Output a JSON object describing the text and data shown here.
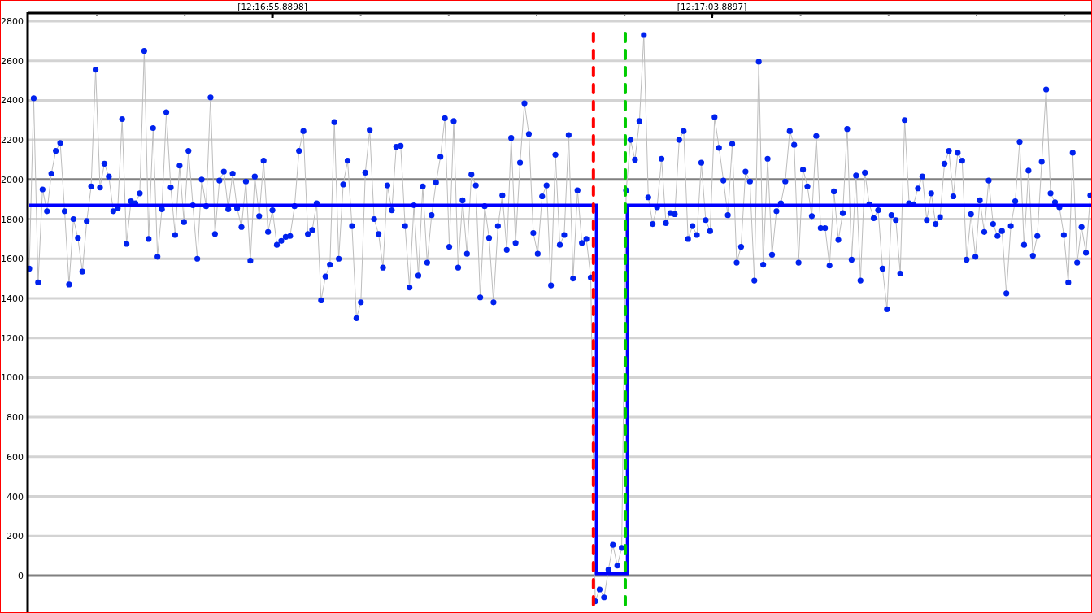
{
  "chart": {
    "chart_data": {
      "type": "line",
      "grid": true,
      "ylim": [
        -185,
        2845
      ],
      "yticks": [
        0,
        200,
        400,
        600,
        800,
        1000,
        1200,
        1400,
        1600,
        1800,
        2000,
        2200,
        2400,
        2600,
        2800
      ],
      "series": [
        {
          "color": "#0022ee",
          "marker": "circle",
          "values": [
            1550,
            2410,
            1480,
            1950,
            1840,
            2030,
            2145,
            2185,
            1840,
            1470,
            1800,
            1705,
            1535,
            1790,
            1965,
            2555,
            1960,
            2080,
            2015,
            1840,
            1855,
            2305,
            1675,
            1890,
            1880,
            1930,
            2650,
            1700,
            2260,
            1610,
            1850,
            2340,
            1960,
            1720,
            2070,
            1785,
            2145,
            1870,
            1600,
            2000,
            1865,
            2415,
            1725,
            1995,
            2040,
            1850,
            2030,
            1855,
            1760,
            1990,
            1590,
            2015,
            1815,
            2095,
            1735,
            1845,
            1670,
            1690,
            1710,
            1715,
            1865,
            2145,
            2245,
            1725,
            1745,
            1880,
            1390,
            1510,
            1570,
            2290,
            1600,
            1975,
            2095,
            1765,
            1300,
            1380,
            2035,
            2250,
            1800,
            1725,
            1555,
            1970,
            1845,
            2165,
            2170,
            1765,
            1455,
            1870,
            1515,
            1965,
            1580,
            1820,
            1985,
            2115,
            2310,
            1660,
            2295,
            1555,
            1895,
            1625,
            2025,
            1970,
            1405,
            1865,
            1705,
            1380,
            1765,
            1920,
            1645,
            2210,
            1680,
            2085,
            2385,
            2230,
            1730,
            1625,
            1915,
            1970,
            1465,
            2125,
            1670,
            1720,
            2225,
            1500,
            1945,
            1680,
            1700,
            1505,
            -130,
            -70,
            -110,
            30,
            155,
            50,
            140,
            1945,
            2200,
            2100,
            2295,
            2730,
            1910,
            1775,
            1860,
            2105,
            1780,
            1830,
            1825,
            2200,
            2245,
            1700,
            1765,
            1720,
            2085,
            1795,
            1740,
            2315,
            2160,
            1995,
            1820,
            2180,
            1580,
            1660,
            2040,
            1990,
            1490,
            2595,
            1570,
            2105,
            1620,
            1840,
            1880,
            1990,
            2245,
            2175,
            1580,
            2050,
            1965,
            1815,
            2220,
            1755,
            1755,
            1565,
            1940,
            1695,
            1830,
            2255,
            1595,
            2020,
            1490,
            2035,
            1875,
            1805,
            1845,
            1550,
            1345,
            1820,
            1795,
            1525,
            2300,
            1880,
            1875,
            1955,
            2015,
            1795,
            1930,
            1775,
            1810,
            2080,
            2145,
            1915,
            2135,
            2095,
            1595,
            1825,
            1610,
            1895,
            1735,
            1995,
            1775,
            1715,
            1740,
            1425,
            1765,
            1890,
            2190,
            1670,
            2045,
            1615,
            1715,
            2090,
            2455,
            1930,
            1885,
            1860,
            1720,
            1480,
            2135,
            1580,
            1760,
            1630,
            1920
          ]
        },
        {
          "color": "#0000ff",
          "values": [
            1870,
            1870,
            1870,
            1870,
            1870,
            1870,
            1870,
            1870,
            1870,
            1870,
            1870,
            1870,
            1870,
            1870,
            1870,
            1870,
            1870,
            1870,
            1870,
            1870,
            1870,
            1870,
            1870,
            1870,
            1870,
            1870,
            1870,
            1870,
            1870,
            1870,
            1870,
            1870,
            1870,
            1870,
            1870,
            1870,
            1870,
            1870,
            1870,
            1870,
            1870,
            1870,
            1870,
            1870,
            1870,
            1870,
            1870,
            1870,
            1870,
            1870,
            1870,
            1870,
            1870,
            1870,
            1870,
            1870,
            1870,
            1870,
            1870,
            1870,
            1870,
            1870,
            1870,
            1870,
            1870,
            1870,
            1870,
            1870,
            1870,
            1870,
            1870,
            1870,
            1870,
            1870,
            1870,
            1870,
            1870,
            1870,
            1870,
            1870,
            1870,
            1870,
            1870,
            1870,
            1870,
            1870,
            1870,
            1870,
            1870,
            1870,
            1870,
            1870,
            1870,
            1870,
            1870,
            1870,
            1870,
            1870,
            1870,
            1870,
            1870,
            1870,
            1870,
            1870,
            1870,
            1870,
            1870,
            1870,
            1870,
            1870,
            1870,
            1870,
            1870,
            1870,
            1870,
            1870,
            1870,
            1870,
            1870,
            1870,
            1870,
            1870,
            1870,
            1870,
            1870,
            1870,
            1870,
            1870,
            1870,
            10,
            10,
            10,
            10,
            10,
            10,
            10,
            1870,
            1870,
            1870,
            1870,
            1870,
            1870,
            1870,
            1870,
            1870,
            1870,
            1870,
            1870,
            1870,
            1870,
            1870,
            1870,
            1870,
            1870,
            1870,
            1870,
            1870,
            1870,
            1870,
            1870,
            1870,
            1870,
            1870,
            1870,
            1870,
            1870,
            1870,
            1870,
            1870,
            1870,
            1870,
            1870,
            1870,
            1870,
            1870,
            1870,
            1870,
            1870,
            1870,
            1870,
            1870,
            1870,
            1870,
            1870,
            1870,
            1870,
            1870,
            1870,
            1870,
            1870,
            1870,
            1870,
            1870,
            1870,
            1870,
            1870,
            1870,
            1870,
            1870,
            1870,
            1870,
            1870,
            1870,
            1870,
            1870,
            1870,
            1870,
            1870,
            1870,
            1870,
            1870,
            1870,
            1870,
            1870,
            1870,
            1870,
            1870,
            1870,
            1870,
            1870,
            1870,
            1870,
            1870,
            1870,
            1870,
            1870,
            1870,
            1870,
            1870,
            1870,
            1870,
            1870,
            1870,
            1870,
            1870,
            1870,
            1870,
            1870,
            1870,
            1870,
            1870
          ]
        }
      ],
      "title": null
    },
    "time_labels": [
      "[12:16:55.8898]",
      "[12:17:03.8897]"
    ],
    "markers": [
      {
        "color": "#ff0000"
      },
      {
        "color": "#00cc00"
      }
    ]
  }
}
